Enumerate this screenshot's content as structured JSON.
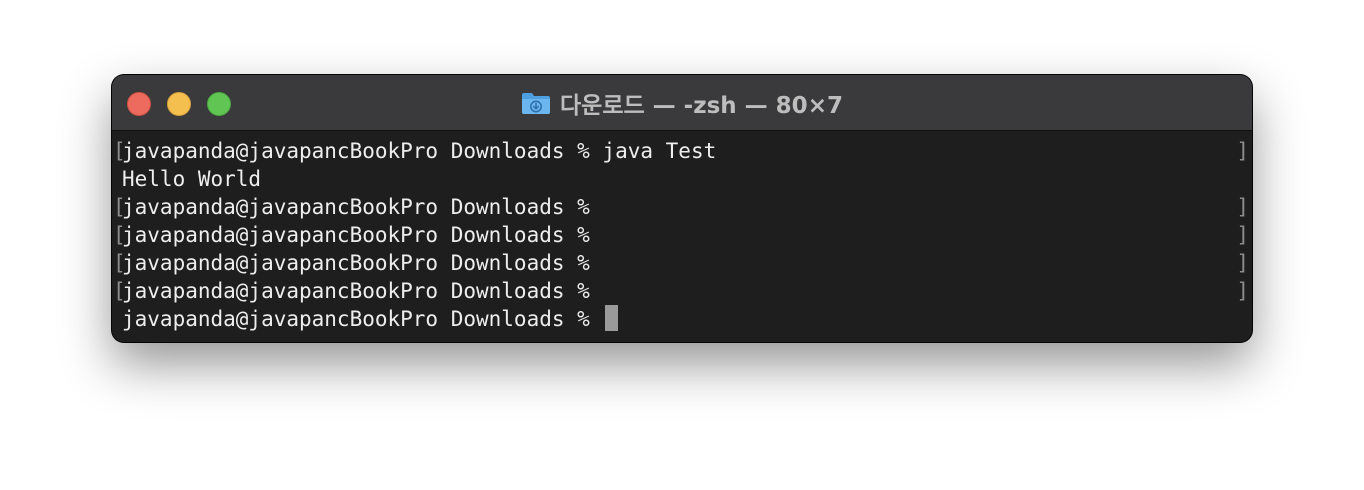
{
  "window": {
    "title": "다운로드 — -zsh — 80×7",
    "title_icon": "folder-download-icon"
  },
  "colors": {
    "terminal_background": "#1e1e1e",
    "titlebar_background": "#3a3a3c",
    "text": "#eeeeee",
    "close": "#ec6a5e",
    "minimize": "#f4bf4f",
    "zoom": "#61c554",
    "folder": "#5aa8e6"
  },
  "terminal": {
    "mark_left": "[",
    "mark_right": "]",
    "lines": [
      {
        "text": "javapanda@javapancBookPro Downloads % java Test"
      },
      {
        "text": "Hello World"
      },
      {
        "text": "javapanda@javapancBookPro Downloads %"
      },
      {
        "text": "javapanda@javapancBookPro Downloads %"
      },
      {
        "text": "javapanda@javapancBookPro Downloads %"
      },
      {
        "text": "javapanda@javapancBookPro Downloads %"
      },
      {
        "text": "javapanda@javapancBookPro Downloads % "
      }
    ]
  }
}
